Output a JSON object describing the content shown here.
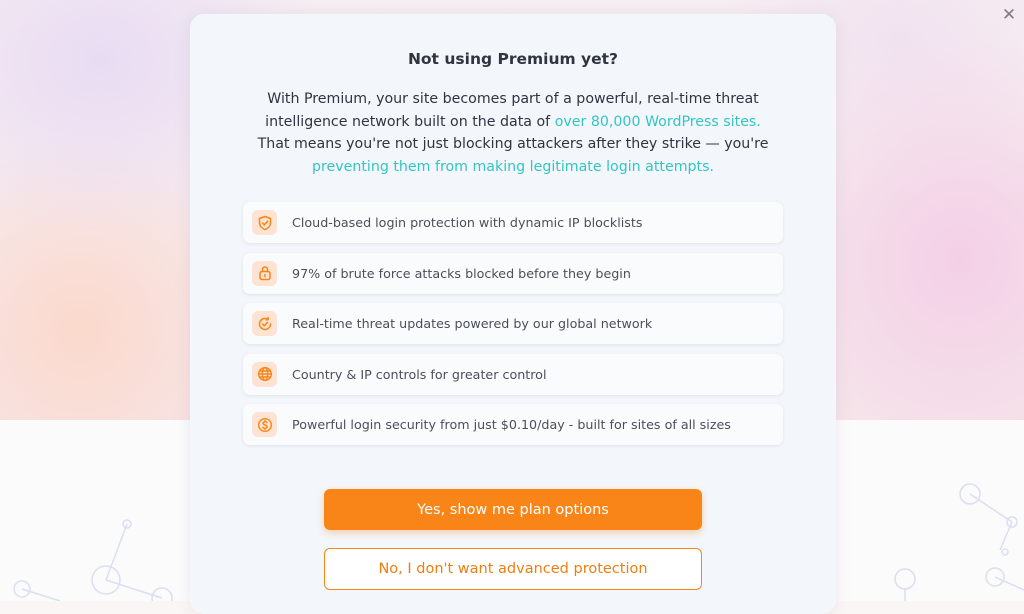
{
  "close": {
    "glyph": "✕"
  },
  "modal": {
    "title": "Not using Premium yet?",
    "description": {
      "part1": "With Premium, your site becomes part of a powerful, real-time threat intelligence network built on the data of ",
      "highlight1": "over 80,000 WordPress sites.",
      "part2": " That means you're not just blocking attackers after they strike — you're ",
      "highlight2": "preventing them from making legitimate login attempts."
    },
    "features": [
      {
        "icon": "shield-check-icon",
        "text": "Cloud-based login protection with dynamic IP blocklists"
      },
      {
        "icon": "lock-icon",
        "text": "97% of brute force attacks blocked before they begin"
      },
      {
        "icon": "refresh-check-icon",
        "text": "Real-time threat updates powered by our global network"
      },
      {
        "icon": "globe-icon",
        "text": "Country & IP controls for greater control"
      },
      {
        "icon": "dollar-icon",
        "text": "Powerful login security from just $0.10/day - built for sites of all sizes"
      }
    ],
    "primary_button": "Yes, show me plan options",
    "secondary_button": "No, I don't want advanced protection"
  },
  "colors": {
    "accent": "#f98519",
    "highlight": "#34c4c4",
    "text": "#2f3440",
    "icon_bg": "#fde3d3"
  }
}
